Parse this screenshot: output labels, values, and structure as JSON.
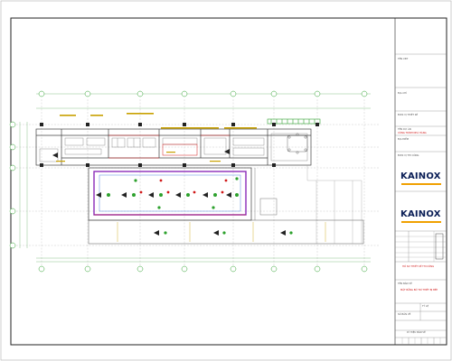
{
  "drawing": {
    "title": "",
    "axis_labels_top": [
      "1",
      "2",
      "3",
      "4",
      "5",
      "6",
      "7",
      "8",
      "9"
    ],
    "axis_labels_side": [
      "A",
      "B",
      "C",
      "D",
      "E"
    ],
    "axis_labels_bottom": [
      "1",
      "2",
      "3",
      "4",
      "5",
      "6",
      "7",
      "8",
      "9"
    ]
  },
  "title_block": {
    "label_owner": "TÊN CĐT",
    "label_address": "ĐỊA CHỈ",
    "label_design": "ĐƠN VỊ THIẾT KẾ",
    "label_project": "TÊN DỰ ÁN",
    "project_name": "CÔNG TRÌNH NHÀ HÀNG",
    "label_location": "ĐỊA ĐIỂM",
    "label_contractor": "ĐƠN VỊ THI CÔNG",
    "brand_1": "KAINOX",
    "brand_2": "KAINOX",
    "stage": "HỒ SƠ THIẾT KẾ THI CÔNG",
    "label_drawing": "TÊN BẢN VẼ",
    "drawing_name": "MẶT BẰNG BỐ TRÍ THIẾT BỊ BẾP",
    "label_scale": "TỶ LỆ",
    "label_number": "SỐ BẢN VẼ",
    "footer": "KÝ HIỆU BẢN VẼ"
  },
  "colors": {
    "line": "#404040",
    "grid": "#9a9a9a",
    "axis_bubble": "#2da12d",
    "red": "#d01818",
    "purple": "#8a2ab8",
    "blue": "#2c6ad8",
    "yellow": "#c8a000",
    "brand_navy": "#0a1e56",
    "brand_accent": "#e03010"
  }
}
